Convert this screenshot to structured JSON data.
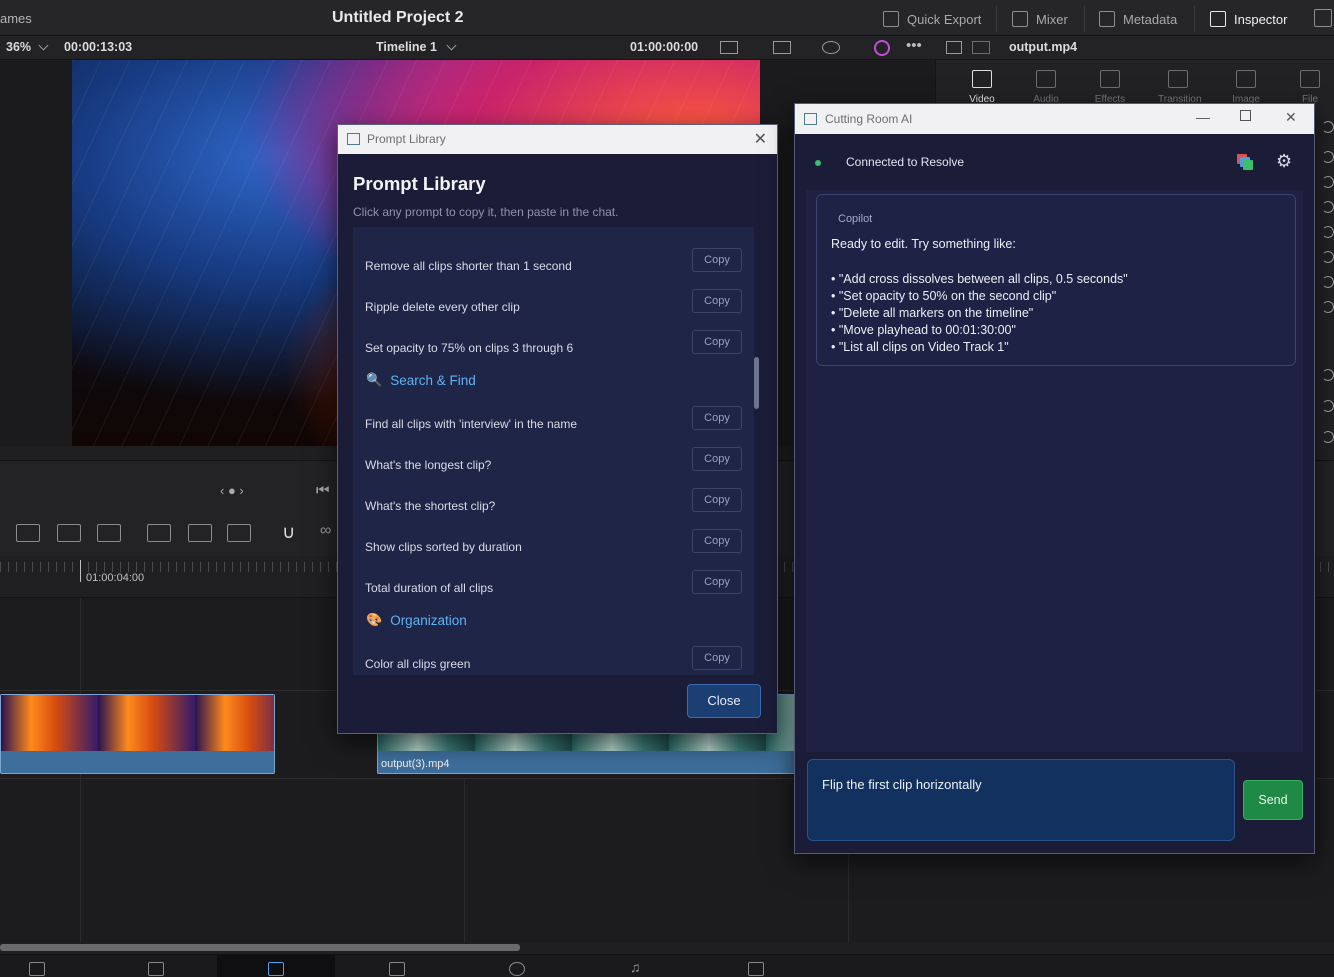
{
  "topbar": {
    "left_fragment": "ames",
    "project_title": "Untitled Project 2",
    "tools": [
      {
        "label": "Quick Export",
        "icon": "export-icon"
      },
      {
        "label": "Mixer",
        "icon": "mixer-icon"
      },
      {
        "label": "Metadata",
        "icon": "metadata-icon"
      },
      {
        "label": "Inspector",
        "icon": "inspector-icon"
      }
    ]
  },
  "viewer_bar": {
    "zoom": "36%",
    "source_timecode": "00:00:13:03",
    "timeline_name": "Timeline 1",
    "record_timecode": "01:00:00:00",
    "clip_name": "output.mp4"
  },
  "inspector_tabs": [
    "Video",
    "Audio",
    "Effects",
    "Transition",
    "Image",
    "File"
  ],
  "timeline": {
    "ruler_label": "01:00:04:00",
    "clips": [
      {
        "name": ""
      },
      {
        "name": "output(3).mp4"
      }
    ]
  },
  "prompt_library": {
    "window_title": "Prompt Library",
    "heading": "Prompt Library",
    "subtitle": "Click any prompt to copy it, then paste in the chat.",
    "copy_label": "Copy",
    "close_label": "Close",
    "items_top": [
      "Remove all clips shorter than 1 second",
      "Ripple delete every other clip",
      "Set opacity to 75% on clips 3 through 6"
    ],
    "category_search": "Search & Find",
    "items_search": [
      "Find all clips with 'interview' in the name",
      "What's the longest clip?",
      "What's the shortest clip?",
      "Show clips sorted by duration",
      "Total duration of all clips"
    ],
    "category_org": "Organization",
    "items_org": [
      "Color all clips green"
    ]
  },
  "cutting_room": {
    "window_title": "Cutting Room AI",
    "status": "Connected to Resolve",
    "message_sender": "Copilot",
    "message_intro": "Ready to edit. Try something like:",
    "suggestions": [
      "• \"Add cross dissolves between all clips, 0.5 seconds\"",
      "• \"Set opacity to 50% on the second clip\"",
      "• \"Delete all markers on the timeline\"",
      "• \"Move playhead to 00:01:30:00\"",
      "• \"List all clips on Video Track 1\""
    ],
    "input_value": "Flip the first clip horizontally",
    "send_label": "Send"
  },
  "colors": {
    "accent_blue": "#5fb3f5",
    "send_green": "#1f8a45",
    "status_green": "#3bbf6a"
  }
}
